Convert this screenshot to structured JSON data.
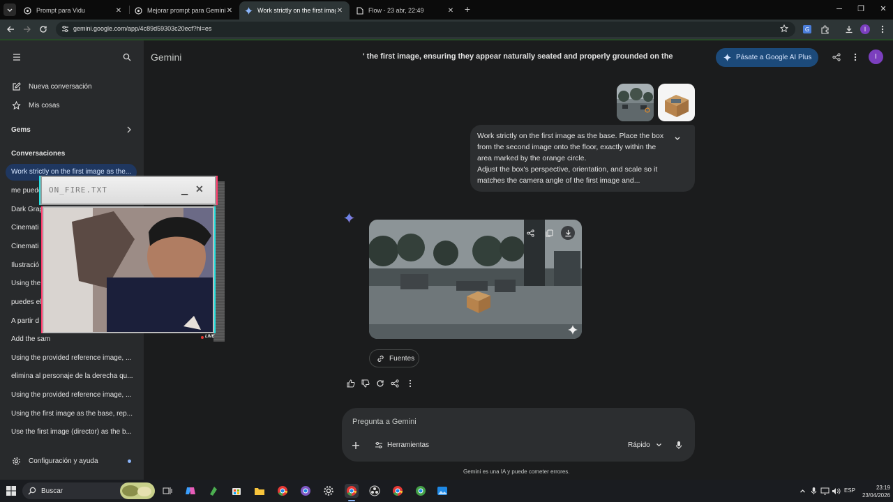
{
  "browser": {
    "tabs": [
      {
        "title": "Prompt para Vidu",
        "active": false
      },
      {
        "title": "Mejorar prompt para Gemini",
        "active": false
      },
      {
        "title": "Work strictly on the first image",
        "active": true
      },
      {
        "title": "Flow - 23 abr, 22:49",
        "active": false
      }
    ],
    "url": "gemini.google.com/app/4c89d59303c20ecf?hl=es",
    "profile_initial": "I"
  },
  "sidebar": {
    "new_chat": "Nueva conversación",
    "my_stuff": "Mis cosas",
    "gems": "Gems",
    "conversations_heading": "Conversaciones",
    "conversations": [
      "Work strictly on the first image as the...",
      "me puede",
      "Dark Grap",
      "Cinemati",
      "Cinemati",
      "Ilustració",
      "Using the",
      "puedes el",
      "A partir d",
      "Add the sam",
      "Using the provided reference image, ...",
      "elimina al personaje de la derecha qu...",
      "Using the provided reference image, ...",
      "Using the first image as the base, rep...",
      "Use the first image (director) as the b..."
    ],
    "settings": "Configuración y ayuda"
  },
  "main": {
    "title": "Gemini",
    "top_prompt": "' the first image, ensuring they appear naturally seated and properly grounded on the",
    "upgrade": "Pásate a Google AI Plus",
    "avatar": "I",
    "user_message": "Work strictly on the first image as the base. Place the box from the second image onto the floor, exactly within the area marked by the orange circle.\nAdjust the box's perspective, orientation, and scale so it matches the camera angle of the first image and...",
    "sources": "Fuentes",
    "composer": {
      "placeholder": "Pregunta a Gemini",
      "tools": "Herramientas",
      "mode": "Rápido"
    },
    "disclaimer": "Gemini es una IA y puede cometer errores."
  },
  "overlay": {
    "title": "ON_FIRE.TXT",
    "live": "LIVE"
  },
  "taskbar": {
    "search": "Buscar",
    "lang": "ESP",
    "time": "23:19",
    "date": "23/04/2026"
  },
  "colors": {
    "accent": "#8ab4f8",
    "upgrade_bg": "#1c4a7a",
    "avatar": "#7b3fbe",
    "selected_conv": "#1f3760"
  }
}
